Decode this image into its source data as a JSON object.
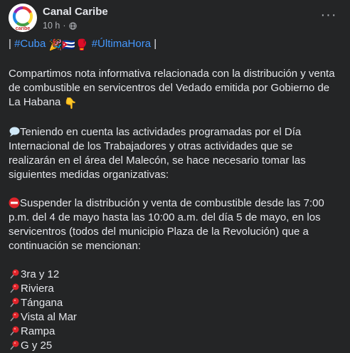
{
  "post": {
    "page_name": "Canal Caribe",
    "time": "10 h",
    "dot": "·",
    "more_label": "···",
    "avatar_text": "caribe",
    "hashtags": {
      "open_bar": "|",
      "tag1": "#Cuba",
      "emoji1": "🎉",
      "emoji2": "🇨🇺",
      "emoji3": "🥊",
      "tag2": "#ÚltimaHora",
      "close_bar": "|"
    },
    "intro": "Compartimos nota informativa relacionada con la distribución y venta de combustible en servicentros del Vedado emitida por Gobierno de La Habana",
    "intro_emoji": "👇",
    "paragraph2": "Teniendo en cuenta las actividades programadas por el Día Internacional de los Trabajadores y otras actividades que se realizarán en el área del Malecón, se hace necesario tomar las siguientes medidas organizativas:",
    "paragraph3": "Suspender la distribución y venta de combustible desde las 7:00 p.m. del 4 de mayo hasta las 10:00 a.m. del día 5 de mayo, en los servicentros (todos del municipio Plaza de la Revolución) que a continuación se mencionan:",
    "locations": [
      "3ra y 12",
      "Riviera",
      "Tángana",
      "Vista al Mar",
      "Rampa",
      "G y 25"
    ]
  },
  "colors": {
    "background": "#242526",
    "text": "#e4e6eb",
    "secondary": "#b0b3b8",
    "link": "#4599ff"
  },
  "icons": {
    "globe": "globe-icon",
    "pin": "round-pushpin-icon",
    "stop": "no-entry-icon",
    "bubble": "speech-bubble-icon"
  }
}
